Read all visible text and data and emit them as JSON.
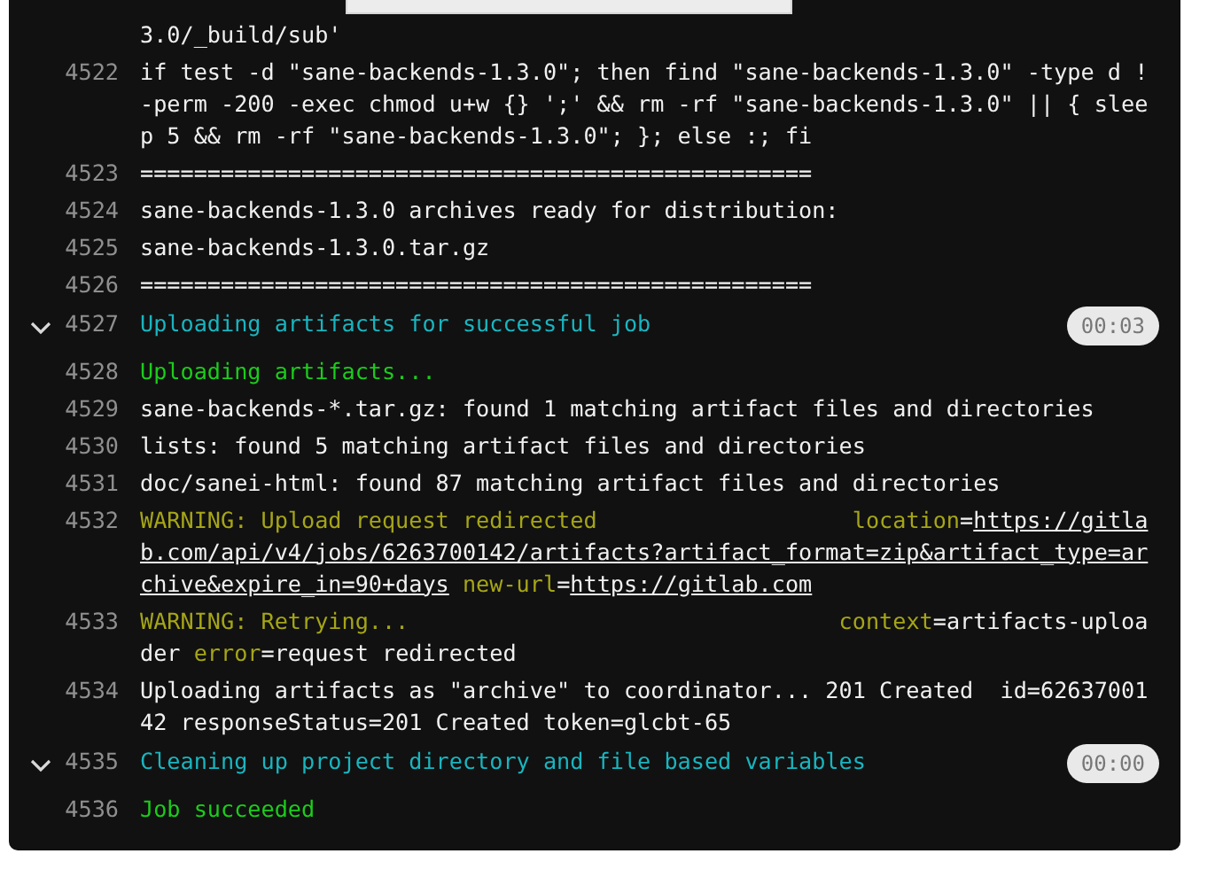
{
  "log_lines": [
    {
      "segments": [
        {
          "kind": "plain",
          "text": "3.0/_build/sub'"
        }
      ]
    },
    {
      "number": "4522",
      "segments": [
        {
          "kind": "plain",
          "text": "if test -d \"sane-backends-1.3.0\"; then find \"sane-backends-1.3.0\" -type d ! -perm -200 -exec chmod u+w {} ';' && rm -rf \"sane-backends-1.3.0\" || { sleep 5 && rm -rf \"sane-backends-1.3.0\"; }; else :; fi"
        }
      ]
    },
    {
      "number": "4523",
      "segments": [
        {
          "kind": "plain",
          "text": "=================================================="
        }
      ]
    },
    {
      "number": "4524",
      "segments": [
        {
          "kind": "plain",
          "text": "sane-backends-1.3.0 archives ready for distribution:"
        }
      ]
    },
    {
      "number": "4525",
      "segments": [
        {
          "kind": "plain",
          "text": "sane-backends-1.3.0.tar.gz"
        }
      ]
    },
    {
      "number": "4526",
      "segments": [
        {
          "kind": "plain",
          "text": "=================================================="
        }
      ]
    },
    {
      "number": "4527",
      "section": {
        "expanded": true,
        "duration": "00:03"
      },
      "segments": [
        {
          "kind": "section",
          "text": "Uploading artifacts for successful job"
        }
      ]
    },
    {
      "number": "4528",
      "segments": [
        {
          "kind": "success",
          "text": "Uploading artifacts..."
        }
      ]
    },
    {
      "number": "4529",
      "segments": [
        {
          "kind": "plain",
          "text": "sane-backends-*.tar.gz: found 1 matching artifact files and directories"
        }
      ]
    },
    {
      "number": "4530",
      "segments": [
        {
          "kind": "plain",
          "text": "lists: found 5 matching artifact files and directories"
        }
      ]
    },
    {
      "number": "4531",
      "segments": [
        {
          "kind": "plain",
          "text": "doc/sanei-html: found 87 matching artifact files and directories"
        }
      ]
    },
    {
      "number": "4532",
      "segments": [
        {
          "kind": "warning",
          "text": "WARNING: Upload request redirected                   "
        },
        {
          "kind": "key",
          "text": "location"
        },
        {
          "kind": "plain",
          "text": "="
        },
        {
          "kind": "link",
          "text": "https://gitlab.com/api/v4/jobs/6263700142/artifacts?artifact_format=zip&artifact_type=archive&expire_in=90+days"
        },
        {
          "kind": "key",
          "text": " new-url"
        },
        {
          "kind": "plain",
          "text": "="
        },
        {
          "kind": "link",
          "text": "https://gitlab.com"
        }
      ]
    },
    {
      "number": "4533",
      "segments": [
        {
          "kind": "warning",
          "text": "WARNING: Retrying...                                "
        },
        {
          "kind": "key",
          "text": "context"
        },
        {
          "kind": "plain",
          "text": "=artifacts-uploader "
        },
        {
          "kind": "key",
          "text": "error"
        },
        {
          "kind": "plain",
          "text": "=request redirected"
        }
      ]
    },
    {
      "number": "4534",
      "segments": [
        {
          "kind": "plain",
          "text": "Uploading artifacts as \"archive\" to coordinator... 201 Created  id=6263700142 responseStatus=201 Created token=glcbt-65"
        }
      ]
    },
    {
      "number": "4535",
      "section": {
        "expanded": true,
        "duration": "00:00"
      },
      "segments": [
        {
          "kind": "section",
          "text": "Cleaning up project directory and file based variables"
        }
      ]
    },
    {
      "number": "4536",
      "segments": [
        {
          "kind": "success",
          "text": "Job succeeded"
        }
      ]
    }
  ]
}
